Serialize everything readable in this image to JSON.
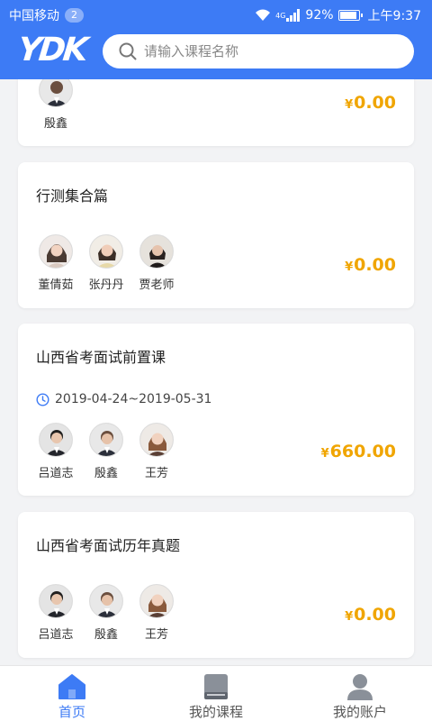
{
  "status_bar": {
    "carrier": "中国移动",
    "badge": "2",
    "signal": "4G",
    "battery": "92%",
    "time": "上午9:37"
  },
  "header": {
    "logo": "YDK",
    "search_placeholder": "请输入课程名称"
  },
  "courses": [
    {
      "title": "",
      "date": "",
      "teachers": [
        {
          "name": "殷鑫",
          "avatar": "male-suit"
        }
      ],
      "price_symbol": "¥",
      "price": "0.00"
    },
    {
      "title": "行测集合篇",
      "date": "",
      "teachers": [
        {
          "name": "董倩茹",
          "avatar": "female"
        },
        {
          "name": "张丹丹",
          "avatar": "female"
        },
        {
          "name": "贾老师",
          "avatar": "female-dark"
        }
      ],
      "price_symbol": "¥",
      "price": "0.00"
    },
    {
      "title": "山西省考面试前置课",
      "date": "2019-04-24~2019-05-31",
      "teachers": [
        {
          "name": "吕道志",
          "avatar": "male-suit"
        },
        {
          "name": "殷鑫",
          "avatar": "male-suit"
        },
        {
          "name": "王芳",
          "avatar": "female"
        }
      ],
      "price_symbol": "¥",
      "price": "660.00"
    },
    {
      "title": "山西省考面试历年真题",
      "date": "",
      "teachers": [
        {
          "name": "吕道志",
          "avatar": "male-suit"
        },
        {
          "name": "殷鑫",
          "avatar": "male-suit"
        },
        {
          "name": "王芳",
          "avatar": "female"
        }
      ],
      "price_symbol": "¥",
      "price": "0.00"
    }
  ],
  "tabbar": {
    "tabs": [
      {
        "label": "首页",
        "icon": "home-icon",
        "active": true
      },
      {
        "label": "我的课程",
        "icon": "book-icon",
        "active": false
      },
      {
        "label": "我的账户",
        "icon": "user-icon",
        "active": false
      }
    ]
  },
  "colors": {
    "primary": "#3d7bf5",
    "price": "#f0a500",
    "background": "#f2f3f5"
  }
}
